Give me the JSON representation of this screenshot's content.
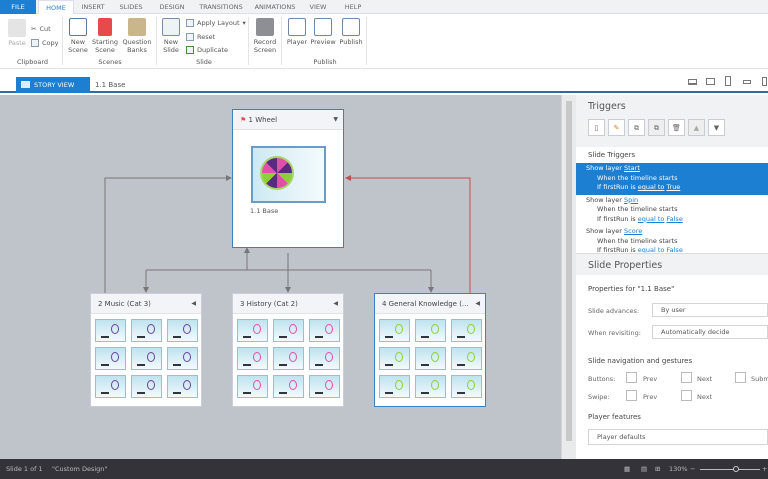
{
  "tabs": [
    "FILE",
    "HOME",
    "INSERT",
    "SLIDES",
    "DESIGN",
    "TRANSITIONS",
    "ANIMATIONS",
    "VIEW",
    "HELP"
  ],
  "ribbon": {
    "paste": "Paste",
    "cut": "Cut",
    "copy": "Copy",
    "clipboard": "Clipboard",
    "new_scene_1": "New",
    "new_scene_2": "Scene",
    "starting_scene_1": "Starting",
    "starting_scene_2": "Scene",
    "question_banks_1": "Question",
    "question_banks_2": "Banks",
    "scenes": "Scenes",
    "new_slide_1": "New",
    "new_slide_2": "Slide",
    "apply_layout": "Apply Layout",
    "reset": "Reset",
    "duplicate": "Duplicate",
    "slide": "Slide",
    "record_1": "Record",
    "record_2": "Screen",
    "player": "Player",
    "preview": "Preview",
    "publish": "Publish",
    "publish_group": "Publish"
  },
  "viewbar": {
    "story_view": "STORY VIEW",
    "breadcrumb": "1.1 Base"
  },
  "scenes": [
    {
      "title": "1 Wheel",
      "slides": [
        "1.1 Base"
      ]
    },
    {
      "title": "2 Music (Cat 3)",
      "color": "#6a3fa0",
      "count": 9
    },
    {
      "title": "3 History (Cat 2)",
      "color": "#e04fa8",
      "count": 9
    },
    {
      "title": "4  General  Knowledge  (...",
      "color": "#8ccf3a",
      "count": 9
    }
  ],
  "triggers": {
    "title": "Triggers",
    "section": "Slide Triggers",
    "items": [
      {
        "action": "Show layer",
        "layer": "Start",
        "when": "When the timeline starts",
        "cond": "If firstRun is",
        "op": "equal to",
        "val": "True"
      },
      {
        "action": "Show layer",
        "layer": "Spin",
        "when": "When the timeline starts",
        "cond": "If firstRun is",
        "op": "equal to",
        "val": "False"
      },
      {
        "action": "Show layer",
        "layer": "Score",
        "when": "When the timeline starts",
        "cond": "If firstRun is",
        "op": "equal to",
        "val": "False"
      }
    ]
  },
  "slide_properties": {
    "title": "Slide Properties",
    "for": "Properties for \"1.1 Base\"",
    "advances_label": "Slide advances:",
    "advances": "By user",
    "revisit_label": "When revisiting:",
    "revisit": "Automatically decide",
    "nav_title": "Slide navigation and gestures",
    "buttons_label": "Buttons:",
    "swipe_label": "Swipe:",
    "prev": "Prev",
    "next": "Next",
    "submit": "Submit",
    "player_title": "Player features",
    "player": "Player defaults"
  },
  "status": {
    "slide": "Slide 1 of 1",
    "design": "\"Custom Design\"",
    "zoom": "130%"
  }
}
